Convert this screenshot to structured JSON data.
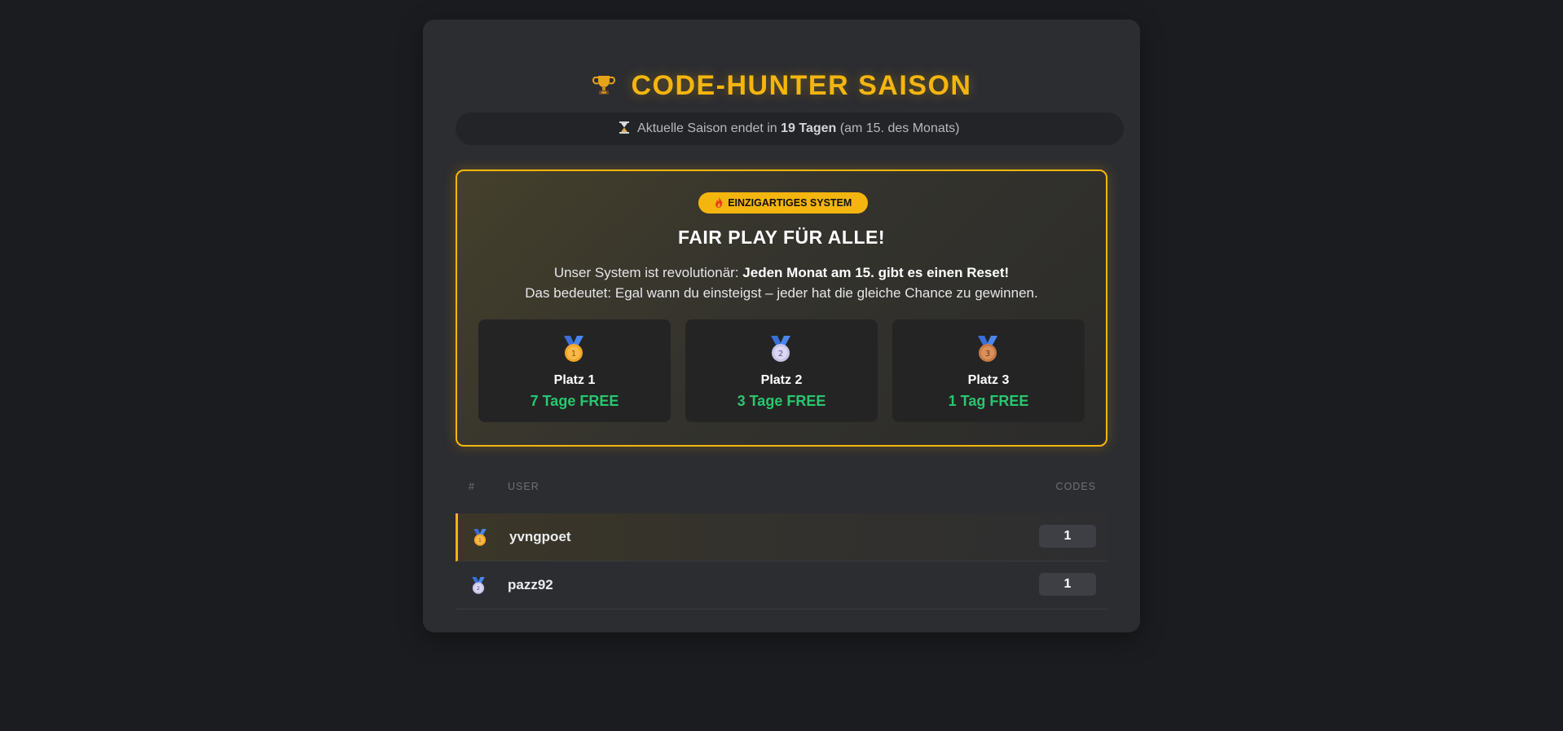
{
  "header": {
    "title": "CODE-HUNTER SAISON",
    "season_prefix": "Aktuelle Saison endet in",
    "season_days": "19 Tagen",
    "season_suffix": "(am 15. des Monats)"
  },
  "promo": {
    "badge": "EINZIGARTIGES SYSTEM",
    "heading": "FAIR PLAY FÜR ALLE!",
    "line1_prefix": "Unser System ist revolutionär:",
    "line1_bold": "Jeden Monat am 15. gibt es einen Reset!",
    "line2": "Das bedeutet: Egal wann du einsteigst – jeder hat die gleiche Chance zu gewinnen.",
    "prizes": [
      {
        "place": "Platz 1",
        "reward": "7 Tage FREE",
        "medal_number": "1"
      },
      {
        "place": "Platz 2",
        "reward": "3 Tage FREE",
        "medal_number": "2"
      },
      {
        "place": "Platz 3",
        "reward": "1 Tag FREE",
        "medal_number": "3"
      }
    ]
  },
  "leaderboard": {
    "columns": {
      "rank": "#",
      "user": "USER",
      "codes": "CODES"
    },
    "rows": [
      {
        "user": "yvngpoet",
        "codes": "1",
        "medal_number": "1"
      },
      {
        "user": "pazz92",
        "codes": "1",
        "medal_number": "2"
      }
    ]
  },
  "colors": {
    "accent": "#f5b50f",
    "reward": "#28c76f",
    "background": "#1b1c1f",
    "card": "#2c2d31"
  }
}
